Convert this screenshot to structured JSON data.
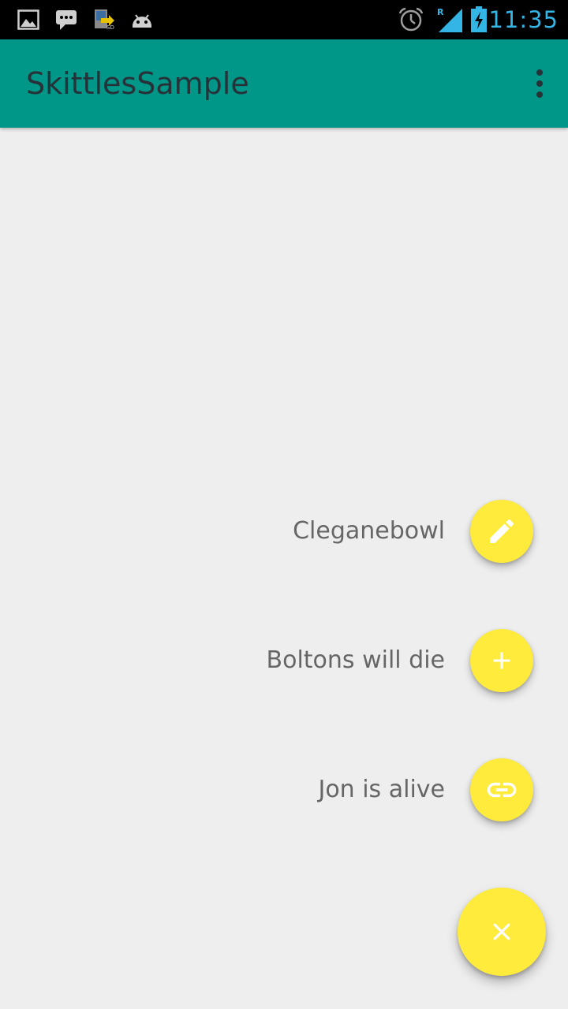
{
  "status_bar": {
    "time": "11:35",
    "left_icons": [
      "gallery-icon",
      "messaging-icon",
      "sd-card-icon",
      "android-debug-icon"
    ],
    "right_icons": [
      "alarm-icon",
      "signal-icon",
      "battery-charging-icon"
    ],
    "signal_roaming_label": "R",
    "accent_color": "#33b5e5"
  },
  "app_bar": {
    "title": "SkittlesSample",
    "color": "#009688",
    "overflow_icon": "more-vert-icon"
  },
  "fab_menu": {
    "fab_color": "#ffeb3b",
    "items": [
      {
        "label": "Cleganebowl",
        "icon": "pencil-icon"
      },
      {
        "label": "Boltons will die",
        "icon": "plus-icon"
      },
      {
        "label": "Jon is alive",
        "icon": "link-icon"
      }
    ],
    "main_icon": "close-icon"
  }
}
